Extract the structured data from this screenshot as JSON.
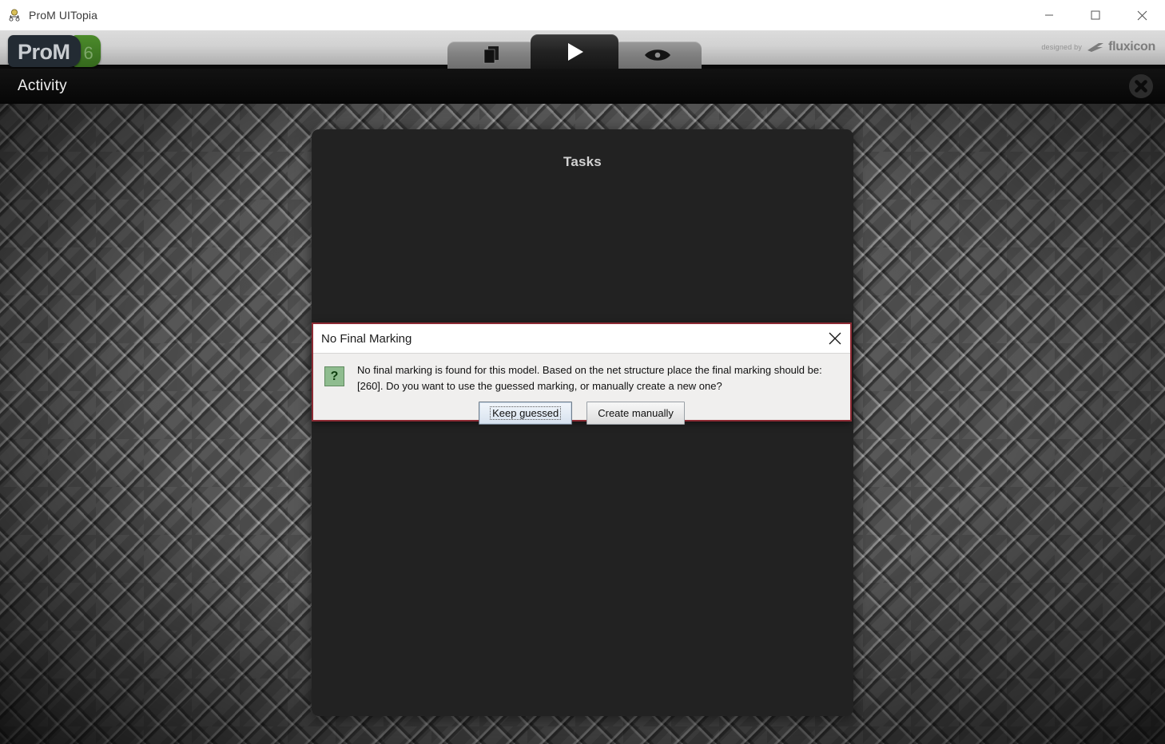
{
  "window": {
    "title": "ProM UITopia",
    "icon": "prom-app-icon",
    "controls": {
      "minimize": "minimize-icon",
      "maximize": "maximize-icon",
      "close": "close-icon"
    }
  },
  "toolbar": {
    "logo": {
      "name": "ProM",
      "version": "6"
    },
    "tabs": [
      {
        "id": "workspace",
        "icon": "documents-icon",
        "state": "inactive"
      },
      {
        "id": "actions",
        "icon": "play-icon",
        "state": "active"
      },
      {
        "id": "views",
        "icon": "eye-icon",
        "state": "inactive"
      }
    ],
    "branding": {
      "prefix": "designed by",
      "name": "fluxicon",
      "logo_icon": "fluxicon-logo-icon"
    }
  },
  "activity_bar": {
    "title": "Activity",
    "close_icon": "activity-close-icon"
  },
  "tasks_panel": {
    "title": "Tasks"
  },
  "dialog": {
    "title": "No Final Marking",
    "close_icon": "dialog-close-icon",
    "icon": "question-icon",
    "icon_glyph": "?",
    "message": "No final marking is found for this model. Based on the net structure place the final marking should be: [260]. Do you want to use the guessed marking, or manually create a new one?",
    "buttons": [
      {
        "label": "Keep guessed",
        "focused": true
      },
      {
        "label": "Create manually",
        "focused": false
      }
    ]
  },
  "colors": {
    "dialog_border": "#8d2b34",
    "logo_green": "#4c8b2b",
    "logo_navy": "#232b33",
    "question_icon_green": "#8fbc8f",
    "panel_dark": "#222222"
  }
}
